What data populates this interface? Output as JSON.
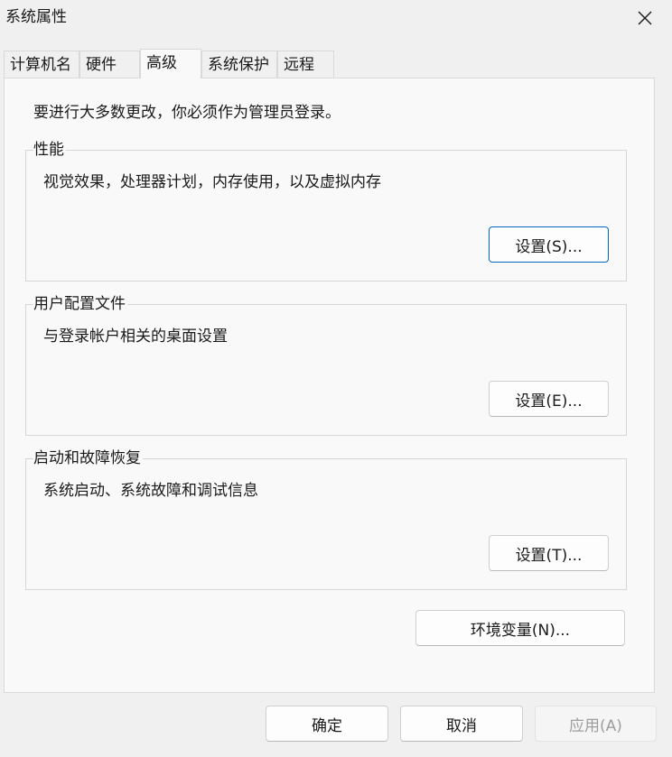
{
  "window": {
    "title": "系统属性"
  },
  "tabs": [
    {
      "label": "计算机名",
      "active": false
    },
    {
      "label": "硬件",
      "active": false
    },
    {
      "label": "高级",
      "active": true
    },
    {
      "label": "系统保护",
      "active": false
    },
    {
      "label": "远程",
      "active": false
    }
  ],
  "panel": {
    "notice": "要进行大多数更改，你必须作为管理员登录。",
    "groups": [
      {
        "label": "性能",
        "description": "视觉效果，处理器计划，内存使用，以及虚拟内存",
        "button": "设置(S)..."
      },
      {
        "label": "用户配置文件",
        "description": "与登录帐户相关的桌面设置",
        "button": "设置(E)..."
      },
      {
        "label": "启动和故障恢复",
        "description": "系统启动、系统故障和调试信息",
        "button": "设置(T)..."
      }
    ],
    "env_button": "环境变量(N)..."
  },
  "footer": {
    "ok": "确定",
    "cancel": "取消",
    "apply": "应用(A)"
  },
  "icons": {
    "close": "close-icon"
  },
  "colors": {
    "focus_border": "#0067c0",
    "window_bg": "#f0f0f0",
    "panel_bg": "#f9f9f9",
    "disabled_text": "#9d9d9d"
  }
}
